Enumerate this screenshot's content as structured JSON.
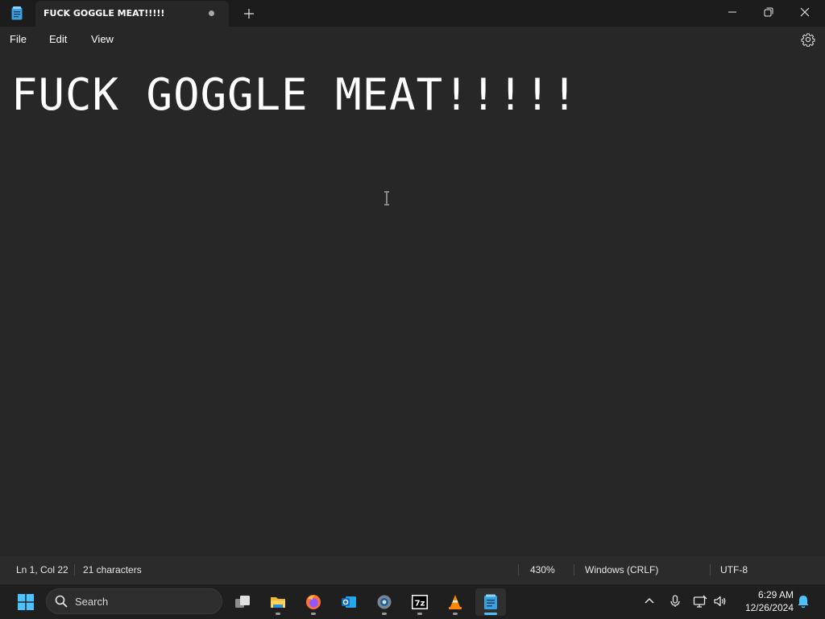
{
  "tab": {
    "title": "FUCK GOGGLE MEAT!!!!!",
    "unsaved": true
  },
  "menu": {
    "file": "File",
    "edit": "Edit",
    "view": "View"
  },
  "editor": {
    "content": "FUCK GOGGLE MEAT!!!!!"
  },
  "status": {
    "position": "Ln 1, Col 22",
    "characters": "21 characters",
    "zoom": "430%",
    "line_ending": "Windows (CRLF)",
    "encoding": "UTF-8"
  },
  "taskbar": {
    "search_label": "Search",
    "pinned": [
      "windows-start",
      "task-view",
      "file-explorer",
      "firefox",
      "outlook",
      "settings",
      "7zip",
      "vlc",
      "notepad"
    ],
    "active": "notepad"
  },
  "clock": {
    "time": "6:29 AM",
    "date": "12/26/2024"
  },
  "colors": {
    "accent": "#4cc2ff",
    "background": "#272727",
    "titlebar": "#1c1c1c"
  }
}
